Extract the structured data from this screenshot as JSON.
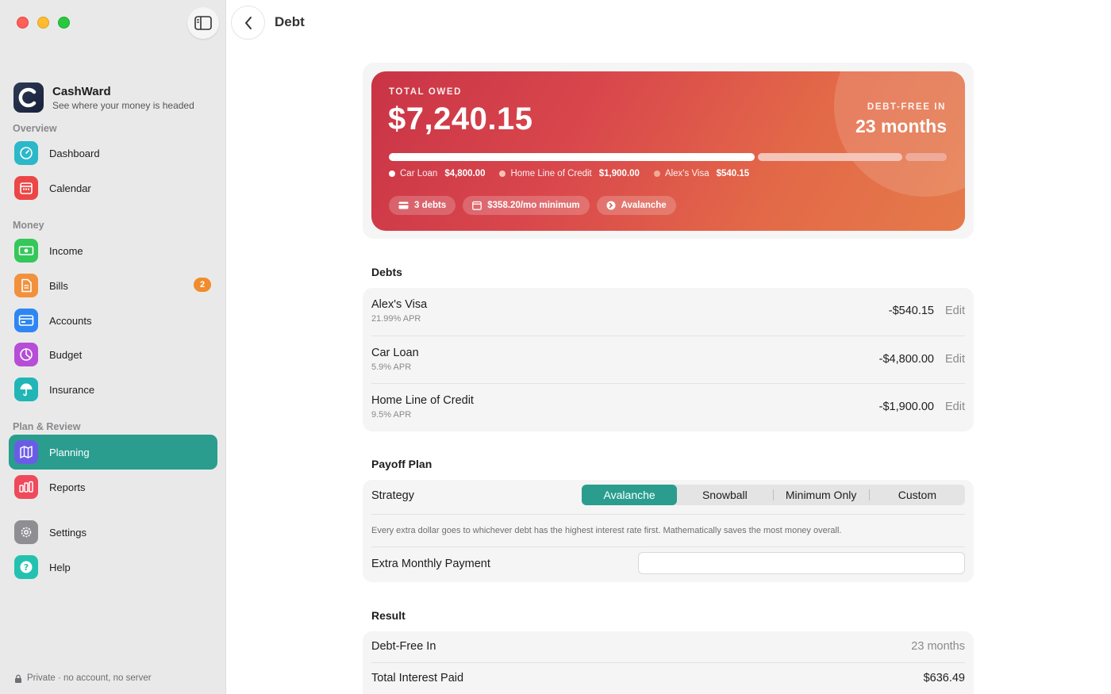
{
  "app": {
    "name": "CashWard",
    "tagline": "See where your money is headed",
    "footer": "Private · no account, no server"
  },
  "sidebar": {
    "sections": [
      {
        "label": "Overview"
      },
      {
        "label": "Money"
      },
      {
        "label": "Plan & Review"
      }
    ],
    "items": [
      {
        "label": "Dashboard",
        "icon": "gauge-icon",
        "color": "#2bb8c9"
      },
      {
        "label": "Calendar",
        "icon": "calendar-icon",
        "color": "#ec4646"
      },
      {
        "label": "Income",
        "icon": "banknote-icon",
        "color": "#34c759"
      },
      {
        "label": "Bills",
        "icon": "document-icon",
        "color": "#f2913d",
        "badge": "2"
      },
      {
        "label": "Accounts",
        "icon": "card-icon",
        "color": "#2f86f3"
      },
      {
        "label": "Budget",
        "icon": "pie-icon",
        "color": "#b64ed8"
      },
      {
        "label": "Insurance",
        "icon": "umbrella-icon",
        "color": "#22b5b5"
      },
      {
        "label": "Planning",
        "icon": "map-icon",
        "color": "#6b5ce7",
        "active": true
      },
      {
        "label": "Reports",
        "icon": "bar-chart-icon",
        "color": "#ef4a5c"
      },
      {
        "label": "Settings",
        "icon": "gear-icon",
        "color": "#8e8e93"
      },
      {
        "label": "Help",
        "icon": "question-icon",
        "color": "#23c2b0"
      }
    ]
  },
  "header": {
    "title": "Debt"
  },
  "hero": {
    "total_label": "TOTAL OWED",
    "total_value": "$7,240.15",
    "free_label": "DEBT-FREE IN",
    "free_value": "23 months",
    "segments": [
      {
        "name": "Car Loan",
        "value": "$4,800.00",
        "fraction": 0.663,
        "color": "#ffffff"
      },
      {
        "name": "Home Line of Credit",
        "value": "$1,900.00",
        "fraction": 0.262,
        "color": "#f5c4b8"
      },
      {
        "name": "Alex's Visa",
        "value": "$540.15",
        "fraction": 0.075,
        "color": "#f0aa9a"
      }
    ],
    "chips": [
      {
        "label": "3 debts",
        "icon": "card-icon"
      },
      {
        "label": "$358.20/mo minimum",
        "icon": "calendar-icon"
      },
      {
        "label": "Avalanche",
        "icon": "arrow-circle-icon"
      }
    ]
  },
  "debts": {
    "title": "Debts",
    "edit_label": "Edit",
    "items": [
      {
        "name": "Alex's Visa",
        "apr": "21.99% APR",
        "amount": "-$540.15"
      },
      {
        "name": "Car Loan",
        "apr": "5.9% APR",
        "amount": "-$4,800.00"
      },
      {
        "name": "Home Line of Credit",
        "apr": "9.5% APR",
        "amount": "-$1,900.00"
      }
    ]
  },
  "payoff": {
    "title": "Payoff Plan",
    "strategy_label": "Strategy",
    "strategies": [
      "Avalanche",
      "Snowball",
      "Minimum Only",
      "Custom"
    ],
    "selected": "Avalanche",
    "description": "Every extra dollar goes to whichever debt has the highest interest rate first. Mathematically saves the most money overall.",
    "extra_label": "Extra Monthly Payment",
    "extra_value": ""
  },
  "result": {
    "title": "Result",
    "rows": [
      {
        "label": "Debt-Free In",
        "value": "23 months",
        "muted": true
      },
      {
        "label": "Total Interest Paid",
        "value": "$636.49",
        "muted": false
      }
    ]
  }
}
